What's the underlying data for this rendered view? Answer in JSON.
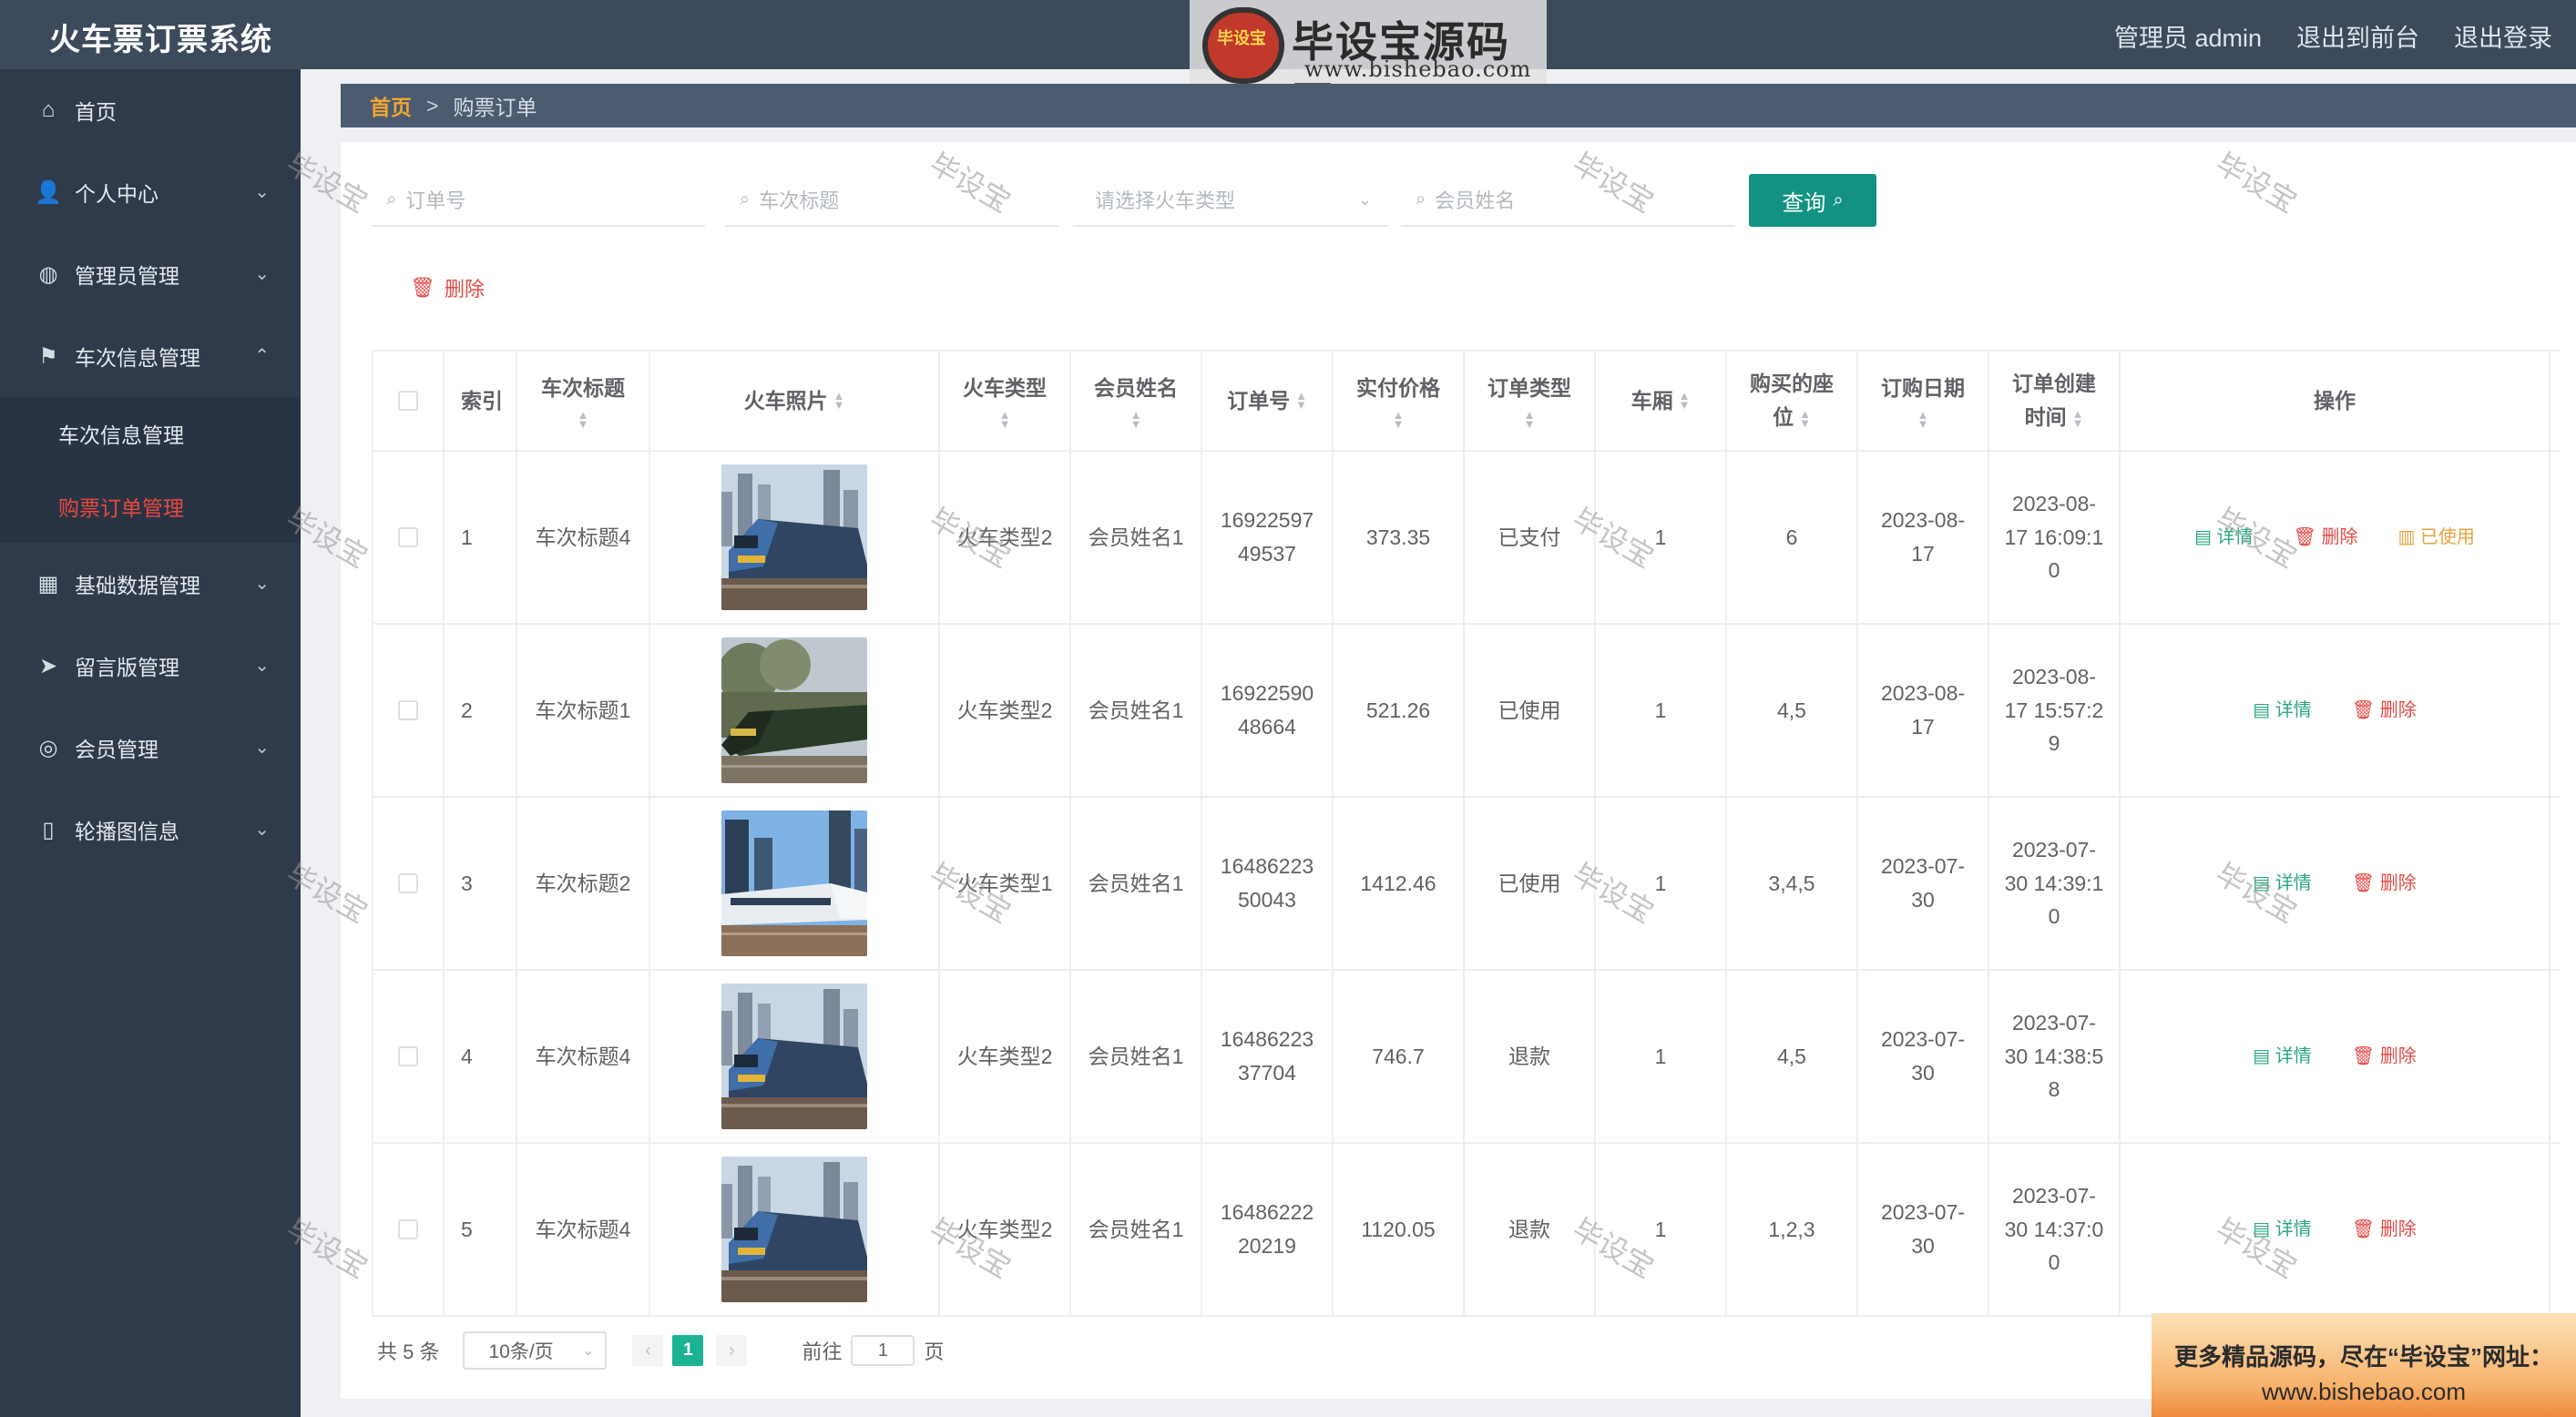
{
  "app": {
    "title": "火车票订票系统"
  },
  "logo": {
    "text": "毕设宝源码网",
    "url": "www.bishebao.com",
    "badge": "毕设宝"
  },
  "top_actions": {
    "user": "管理员 admin",
    "front": "退出到前台",
    "logout": "退出登录"
  },
  "sidebar": {
    "items": [
      {
        "label": "首页",
        "icon": "home-icon",
        "glyph": "⌂"
      },
      {
        "label": "个人中心",
        "icon": "user-icon",
        "glyph": "👤"
      },
      {
        "label": "管理员管理",
        "icon": "globe-icon",
        "glyph": "◍"
      },
      {
        "label": "车次信息管理",
        "icon": "flag-icon",
        "glyph": "⚑"
      },
      {
        "label": "车次信息管理",
        "icon": "",
        "glyph": ""
      },
      {
        "label": "购票订单管理",
        "icon": "",
        "glyph": ""
      },
      {
        "label": "基础数据管理",
        "icon": "grid-icon",
        "glyph": "▦"
      },
      {
        "label": "留言版管理",
        "icon": "send-icon",
        "glyph": "➤"
      },
      {
        "label": "会员管理",
        "icon": "compass-icon",
        "glyph": "◎"
      },
      {
        "label": "轮播图信息",
        "icon": "phone-icon",
        "glyph": "▯"
      }
    ]
  },
  "breadcrumb": {
    "home": "首页",
    "sep": ">",
    "current": "购票订单"
  },
  "search": {
    "order_no_placeholder": "订单号",
    "train_title_placeholder": "车次标题",
    "train_type_placeholder": "请选择火车类型",
    "member_name_placeholder": "会员姓名",
    "query_label": "查询"
  },
  "toolbar": {
    "delete_label": "删除"
  },
  "table": {
    "headers": {
      "index": "索引",
      "title": "车次标题",
      "photo": "火车照片",
      "type": "火车类型",
      "member": "会员姓名",
      "order_no": "订单号",
      "price": "实付价格",
      "order_type": "订单类型",
      "car": "车厢",
      "seats_1": "购买的座",
      "seats_2": "位",
      "date": "订购日期",
      "created_1": "订单创建",
      "created_2": "时间",
      "ops": "操作"
    },
    "rows": [
      {
        "index": "1",
        "title": "车次标题4",
        "type": "火车类型2",
        "member": "会员姓名1",
        "order_no_1": "16922597",
        "order_no_2": "49537",
        "price": "373.35",
        "order_type": "已支付",
        "car": "1",
        "seats": "6",
        "date_1": "2023-08-",
        "date_2": "17",
        "created_1": "2023-08-",
        "created_2": "17 16:09:1",
        "created_3": "0",
        "detail": "详情",
        "delete": "删除",
        "used": "已使用"
      },
      {
        "index": "2",
        "title": "车次标题1",
        "type": "火车类型2",
        "member": "会员姓名1",
        "order_no_1": "16922590",
        "order_no_2": "48664",
        "price": "521.26",
        "order_type": "已使用",
        "car": "1",
        "seats": "4,5",
        "date_1": "2023-08-",
        "date_2": "17",
        "created_1": "2023-08-",
        "created_2": "17 15:57:2",
        "created_3": "9",
        "detail": "详情",
        "delete": "删除"
      },
      {
        "index": "3",
        "title": "车次标题2",
        "type": "火车类型1",
        "member": "会员姓名1",
        "order_no_1": "16486223",
        "order_no_2": "50043",
        "price": "1412.46",
        "order_type": "已使用",
        "car": "1",
        "seats": "3,4,5",
        "date_1": "2023-07-",
        "date_2": "30",
        "created_1": "2023-07-",
        "created_2": "30 14:39:1",
        "created_3": "0",
        "detail": "详情",
        "delete": "删除"
      },
      {
        "index": "4",
        "title": "车次标题4",
        "type": "火车类型2",
        "member": "会员姓名1",
        "order_no_1": "16486223",
        "order_no_2": "37704",
        "price": "746.7",
        "order_type": "退款",
        "car": "1",
        "seats": "4,5",
        "date_1": "2023-07-",
        "date_2": "30",
        "created_1": "2023-07-",
        "created_2": "30 14:38:5",
        "created_3": "8",
        "detail": "详情",
        "delete": "删除"
      },
      {
        "index": "5",
        "title": "车次标题4",
        "type": "火车类型2",
        "member": "会员姓名1",
        "order_no_1": "16486222",
        "order_no_2": "20219",
        "price": "1120.05",
        "order_type": "退款",
        "car": "1",
        "seats": "1,2,3",
        "date_1": "2023-07-",
        "date_2": "30",
        "created_1": "2023-07-",
        "created_2": "30 14:37:0",
        "created_3": "0",
        "detail": "详情",
        "delete": "删除"
      }
    ]
  },
  "pagination": {
    "total": "共 5 条",
    "page_size": "10条/页",
    "current": "1",
    "goto": "前往",
    "goto_value": "1",
    "page_unit": "页"
  },
  "watermark": "毕设宝",
  "promo": {
    "line1": "更多精品源码，尽在“毕设宝”网址：",
    "line2": "www.bishebao.com"
  },
  "colors": {
    "topbar": "#3c4a5c",
    "sidebar": "#2f3b4b",
    "accent": "#139283",
    "active_menu": "#e9473f",
    "danger": "#e14b47",
    "success": "#2aa87a",
    "warning": "#e6a23c"
  }
}
